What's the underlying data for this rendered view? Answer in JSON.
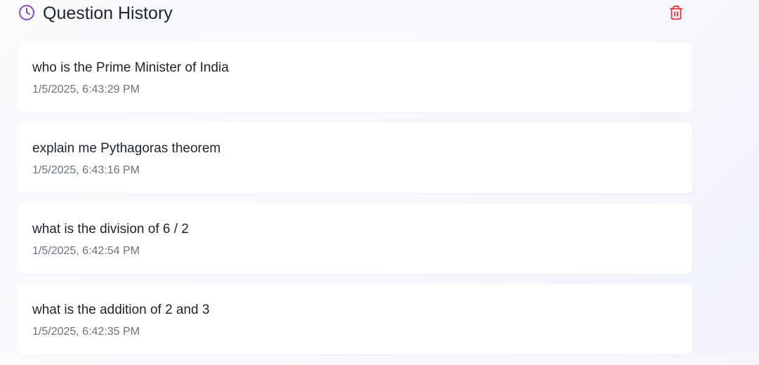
{
  "header": {
    "title": "Question History",
    "icon": "clock-icon",
    "accent_color": "#8b47d9",
    "clear_icon": "trash-icon",
    "clear_color": "#e5323a"
  },
  "history": {
    "items": [
      {
        "question": "who is the Prime Minister of India",
        "timestamp": "1/5/2025, 6:43:29 PM"
      },
      {
        "question": "explain me Pythagoras theorem",
        "timestamp": "1/5/2025, 6:43:16 PM"
      },
      {
        "question": "what is the division of 6 / 2",
        "timestamp": "1/5/2025, 6:42:54 PM"
      },
      {
        "question": "what is the addition of 2 and 3",
        "timestamp": "1/5/2025, 6:42:35 PM"
      }
    ]
  }
}
